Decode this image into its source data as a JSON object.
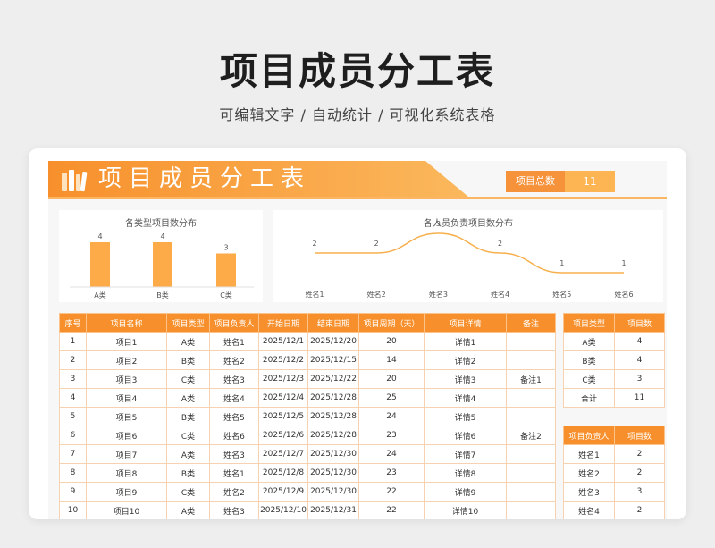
{
  "hero": {
    "title": "项目成员分工表",
    "subtitle": "可编辑文字 / 自动统计 / 可视化系统表格"
  },
  "sheet": {
    "title": "项目成员分工表",
    "total_label": "项目总数",
    "total_value": "11"
  },
  "colors": {
    "accent": "#f7902c",
    "accent_light": "#fbb85d",
    "bar": "#fdab48",
    "line": "#f7b04e"
  },
  "icons": {
    "title_icon": "books-icon"
  },
  "chart_data": [
    {
      "type": "bar",
      "title": "各类型项目数分布",
      "categories": [
        "A类",
        "B类",
        "C类"
      ],
      "values": [
        4,
        4,
        3
      ],
      "ylim": [
        0,
        5
      ]
    },
    {
      "type": "line",
      "title": "各人员负责项目数分布",
      "categories": [
        "姓名1",
        "姓名2",
        "姓名3",
        "姓名4",
        "姓名5",
        "姓名6"
      ],
      "values": [
        2,
        2,
        3,
        2,
        1,
        1
      ],
      "ylim": [
        0,
        4
      ]
    }
  ],
  "main_table": {
    "headers": [
      "序号",
      "项目名称",
      "项目类型",
      "项目负责人",
      "开始日期",
      "结束日期",
      "项目周期（天）",
      "项目详情",
      "备注"
    ],
    "rows": [
      [
        "1",
        "项目1",
        "A类",
        "姓名1",
        "2025/12/1",
        "2025/12/20",
        "20",
        "详情1",
        ""
      ],
      [
        "2",
        "项目2",
        "B类",
        "姓名2",
        "2025/12/2",
        "2025/12/15",
        "14",
        "详情2",
        ""
      ],
      [
        "3",
        "项目3",
        "C类",
        "姓名3",
        "2025/12/3",
        "2025/12/22",
        "20",
        "详情3",
        "备注1"
      ],
      [
        "4",
        "项目4",
        "A类",
        "姓名4",
        "2025/12/4",
        "2025/12/28",
        "25",
        "详情4",
        ""
      ],
      [
        "5",
        "项目5",
        "B类",
        "姓名5",
        "2025/12/5",
        "2025/12/28",
        "24",
        "详情5",
        ""
      ],
      [
        "6",
        "项目6",
        "C类",
        "姓名6",
        "2025/12/6",
        "2025/12/28",
        "23",
        "详情6",
        "备注2"
      ],
      [
        "7",
        "项目7",
        "A类",
        "姓名3",
        "2025/12/7",
        "2025/12/30",
        "24",
        "详情7",
        ""
      ],
      [
        "8",
        "项目8",
        "B类",
        "姓名1",
        "2025/12/8",
        "2025/12/30",
        "23",
        "详情8",
        ""
      ],
      [
        "9",
        "项目9",
        "C类",
        "姓名2",
        "2025/12/9",
        "2025/12/30",
        "22",
        "详情9",
        ""
      ],
      [
        "10",
        "项目10",
        "A类",
        "姓名3",
        "2025/12/10",
        "2025/12/31",
        "22",
        "详情10",
        ""
      ]
    ]
  },
  "type_table": {
    "headers": [
      "项目类型",
      "项目数"
    ],
    "rows": [
      [
        "A类",
        "4"
      ],
      [
        "B类",
        "4"
      ],
      [
        "C类",
        "3"
      ],
      [
        "合计",
        "11"
      ]
    ]
  },
  "owner_table": {
    "headers": [
      "项目负责人",
      "项目数"
    ],
    "rows": [
      [
        "姓名1",
        "2"
      ],
      [
        "姓名2",
        "2"
      ],
      [
        "姓名3",
        "3"
      ],
      [
        "姓名4",
        "2"
      ]
    ]
  }
}
